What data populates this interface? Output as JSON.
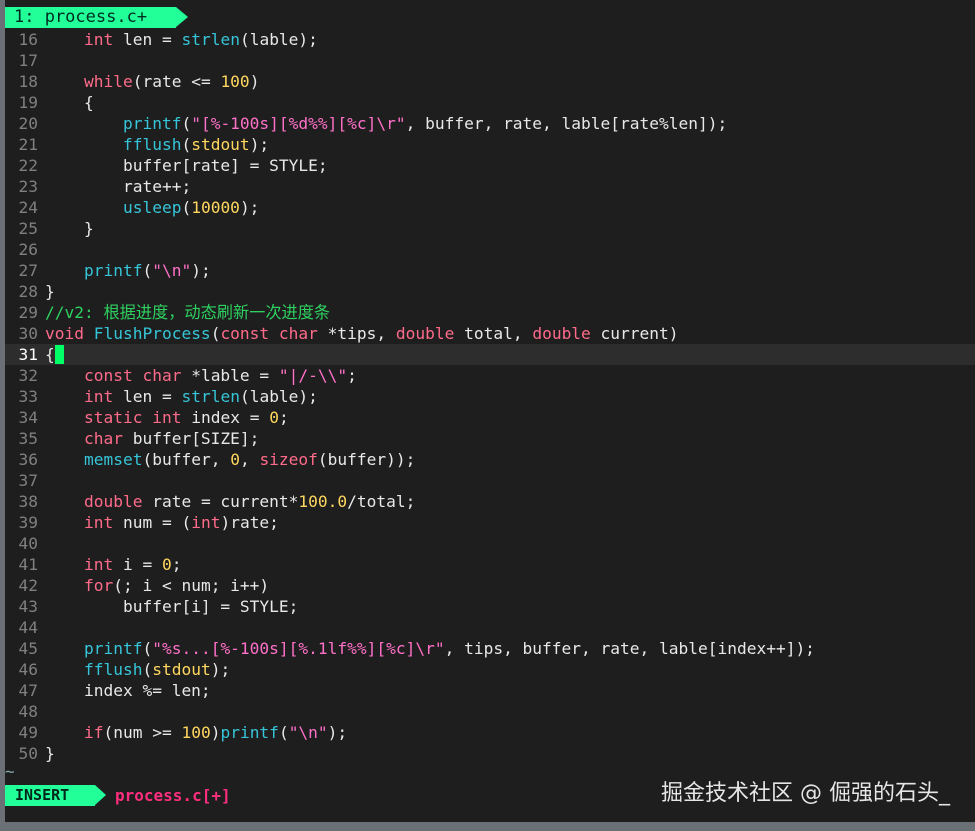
{
  "tab": {
    "label": "1: process.c+"
  },
  "editor": {
    "lines": [
      {
        "n": "16",
        "html": "    <span class=\"kw\">int</span> len = <span class=\"fn\">strlen</span>(lable);"
      },
      {
        "n": "17",
        "html": ""
      },
      {
        "n": "18",
        "html": "    <span class=\"kw\">while</span>(rate &lt;= <span class=\"num\">100</span>)"
      },
      {
        "n": "19",
        "html": "    {"
      },
      {
        "n": "20",
        "html": "        <span class=\"fn\">printf</span>(<span class=\"str\">\"[%-100s][%d%%][%c]\\r\"</span>, buffer, rate, lable[rate%len]);"
      },
      {
        "n": "21",
        "html": "        <span class=\"fn\">fflush</span>(<span class=\"num\">stdout</span>);"
      },
      {
        "n": "22",
        "html": "        buffer[rate] = STYLE;"
      },
      {
        "n": "23",
        "html": "        rate++;"
      },
      {
        "n": "24",
        "html": "        <span class=\"fn\">usleep</span>(<span class=\"num\">10000</span>);"
      },
      {
        "n": "25",
        "html": "    }"
      },
      {
        "n": "26",
        "html": ""
      },
      {
        "n": "27",
        "html": "    <span class=\"fn\">printf</span>(<span class=\"str\">\"\\n\"</span>);"
      },
      {
        "n": "28",
        "html": "}"
      },
      {
        "n": "29",
        "html": "<span class=\"cm\">//v2: 根据进度，动态刷新一次进度条</span>"
      },
      {
        "n": "30",
        "html": "<span class=\"kw\">void</span> <span class=\"fn\">FlushProcess</span>(<span class=\"kw\">const</span> <span class=\"kw\">char</span> *tips, <span class=\"kw\">double</span> total, <span class=\"kw\">double</span> current)"
      },
      {
        "n": "31",
        "html": "{<span class=\"cursor\" data-name=\"text-cursor\" data-interactable=\"false\"></span>",
        "current": true
      },
      {
        "n": "32",
        "html": "    <span class=\"kw\">const</span> <span class=\"kw\">char</span> *lable = <span class=\"str\">\"|/-\\\\\"</span>;"
      },
      {
        "n": "33",
        "html": "    <span class=\"kw\">int</span> len = <span class=\"fn\">strlen</span>(lable);"
      },
      {
        "n": "34",
        "html": "    <span class=\"kw\">static</span> <span class=\"kw\">int</span> index = <span class=\"num\">0</span>;"
      },
      {
        "n": "35",
        "html": "    <span class=\"kw\">char</span> buffer[SIZE];"
      },
      {
        "n": "36",
        "html": "    <span class=\"fn\">memset</span>(buffer, <span class=\"num\">0</span>, <span class=\"kw\">sizeof</span>(buffer));"
      },
      {
        "n": "37",
        "html": ""
      },
      {
        "n": "38",
        "html": "    <span class=\"kw\">double</span> rate = current*<span class=\"num\">100.0</span>/total;"
      },
      {
        "n": "39",
        "html": "    <span class=\"kw\">int</span> num = (<span class=\"kw\">int</span>)rate;"
      },
      {
        "n": "40",
        "html": ""
      },
      {
        "n": "41",
        "html": "    <span class=\"kw\">int</span> i = <span class=\"num\">0</span>;"
      },
      {
        "n": "42",
        "html": "    <span class=\"kw\">for</span>(; i &lt; num; i++)"
      },
      {
        "n": "43",
        "html": "        buffer[i] = STYLE;"
      },
      {
        "n": "44",
        "html": ""
      },
      {
        "n": "45",
        "html": "    <span class=\"fn\">printf</span>(<span class=\"str\">\"%s...[%-100s][%.1lf%%][%c]\\r\"</span>, tips, buffer, rate, lable[index++]);"
      },
      {
        "n": "46",
        "html": "    <span class=\"fn\">fflush</span>(<span class=\"num\">stdout</span>);"
      },
      {
        "n": "47",
        "html": "    index %= len;"
      },
      {
        "n": "48",
        "html": ""
      },
      {
        "n": "49",
        "html": "    <span class=\"kw\">if</span>(num &gt;= <span class=\"num\">100</span>)<span class=\"fn\">printf</span>(<span class=\"str\">\"\\n\"</span>);"
      },
      {
        "n": "50",
        "html": "}"
      }
    ]
  },
  "tilde": "~",
  "status": {
    "mode": "INSERT",
    "file": "process.c[+]"
  },
  "watermark": "掘金技术社区 @ 倔强的石头_",
  "colors": {
    "accent": "#22ff99",
    "keyword": "#ff6b8a",
    "function": "#36c5d8",
    "number": "#ffd75f",
    "string": "#ff70c8",
    "comment": "#2ed160",
    "status_file": "#ff2e7e"
  }
}
